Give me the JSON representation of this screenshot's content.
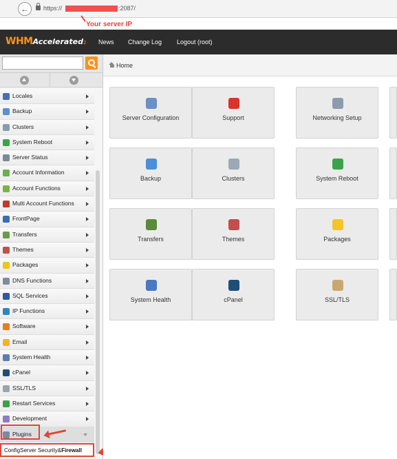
{
  "browser": {
    "back_icon": "back-arrow-icon",
    "url_prefix": "https://",
    "url_suffix": ":2087/"
  },
  "annotation": {
    "server_ip_label": "Your server IP",
    "color": "#e0453a"
  },
  "header": {
    "logo_whm": "WHM",
    "logo_accelerated": "Accelerated",
    "logo_sub": "2",
    "nav": [
      "News",
      "Change Log",
      "Logout (root)"
    ]
  },
  "search": {
    "placeholder": "",
    "value": ""
  },
  "breadcrumb": {
    "home": "Home"
  },
  "sidebar": {
    "items": [
      {
        "label": "Locales",
        "icon": "locales-icon",
        "color": "#4a6fb5"
      },
      {
        "label": "Backup",
        "icon": "backup-icon",
        "color": "#5a8fd0"
      },
      {
        "label": "Clusters",
        "icon": "clusters-icon",
        "color": "#8a9bb0"
      },
      {
        "label": "System Reboot",
        "icon": "reboot-icon",
        "color": "#3aa34a"
      },
      {
        "label": "Server Status",
        "icon": "server-status-icon",
        "color": "#7a8a9a"
      },
      {
        "label": "Account Information",
        "icon": "account-info-icon",
        "color": "#6ab04c"
      },
      {
        "label": "Account Functions",
        "icon": "account-functions-icon",
        "color": "#7cb342"
      },
      {
        "label": "Multi Account Functions",
        "icon": "multi-account-icon",
        "color": "#c0392b"
      },
      {
        "label": "FrontPage",
        "icon": "frontpage-icon",
        "color": "#3a6db5"
      },
      {
        "label": "Transfers",
        "icon": "transfers-icon",
        "color": "#6a9a4a"
      },
      {
        "label": "Themes",
        "icon": "themes-icon",
        "color": "#c0504d"
      },
      {
        "label": "Packages",
        "icon": "packages-icon",
        "color": "#f1c40f"
      },
      {
        "label": "DNS Functions",
        "icon": "dns-icon",
        "color": "#7f8c9d"
      },
      {
        "label": "SQL Services",
        "icon": "sql-icon",
        "color": "#2c5aa0"
      },
      {
        "label": "IP Functions",
        "icon": "ip-icon",
        "color": "#2e86c1"
      },
      {
        "label": "Software",
        "icon": "software-icon",
        "color": "#e67e22"
      },
      {
        "label": "Email",
        "icon": "email-icon",
        "color": "#f0b429"
      },
      {
        "label": "System Health",
        "icon": "system-health-icon",
        "color": "#5b7fb5"
      },
      {
        "label": "cPanel",
        "icon": "cpanel-icon",
        "color": "#1f4e79"
      },
      {
        "label": "SSL/TLS",
        "icon": "ssl-icon",
        "color": "#9aa5b1"
      },
      {
        "label": "Restart Services",
        "icon": "restart-icon",
        "color": "#3aa34a"
      },
      {
        "label": "Development",
        "icon": "development-icon",
        "color": "#8e7cc3"
      },
      {
        "label": "Plugins",
        "icon": "plugins-icon",
        "color": "#7a8a9a"
      }
    ],
    "plugin_sub": {
      "prefix": "ConfigServer Security&",
      "bold": "Firewall"
    }
  },
  "tiles": [
    {
      "label": "Server Configuration",
      "icon": "server-configuration-icon",
      "color": "#6b8fc7"
    },
    {
      "label": "Support",
      "icon": "support-icon",
      "color": "#d9342b"
    },
    {
      "label": "Networking Setup",
      "icon": "networking-icon",
      "color": "#8d9aab"
    },
    {
      "label": "Backup",
      "icon": "backup-icon",
      "color": "#4a90d9"
    },
    {
      "label": "Clusters",
      "icon": "clusters-icon",
      "color": "#9aa8b8"
    },
    {
      "label": "System Reboot",
      "icon": "reboot-icon",
      "color": "#3aa34a"
    },
    {
      "label": "Transfers",
      "icon": "transfers-icon",
      "color": "#5a8a3a"
    },
    {
      "label": "Themes",
      "icon": "themes-icon",
      "color": "#c0504d"
    },
    {
      "label": "Packages",
      "icon": "packages-icon",
      "color": "#f4c430"
    },
    {
      "label": "System Health",
      "icon": "system-health-icon",
      "color": "#4a78c2"
    },
    {
      "label": "cPanel",
      "icon": "cpanel-icon",
      "color": "#1f4e79"
    },
    {
      "label": "SSL/TLS",
      "icon": "ssl-icon",
      "color": "#c8a870"
    }
  ]
}
